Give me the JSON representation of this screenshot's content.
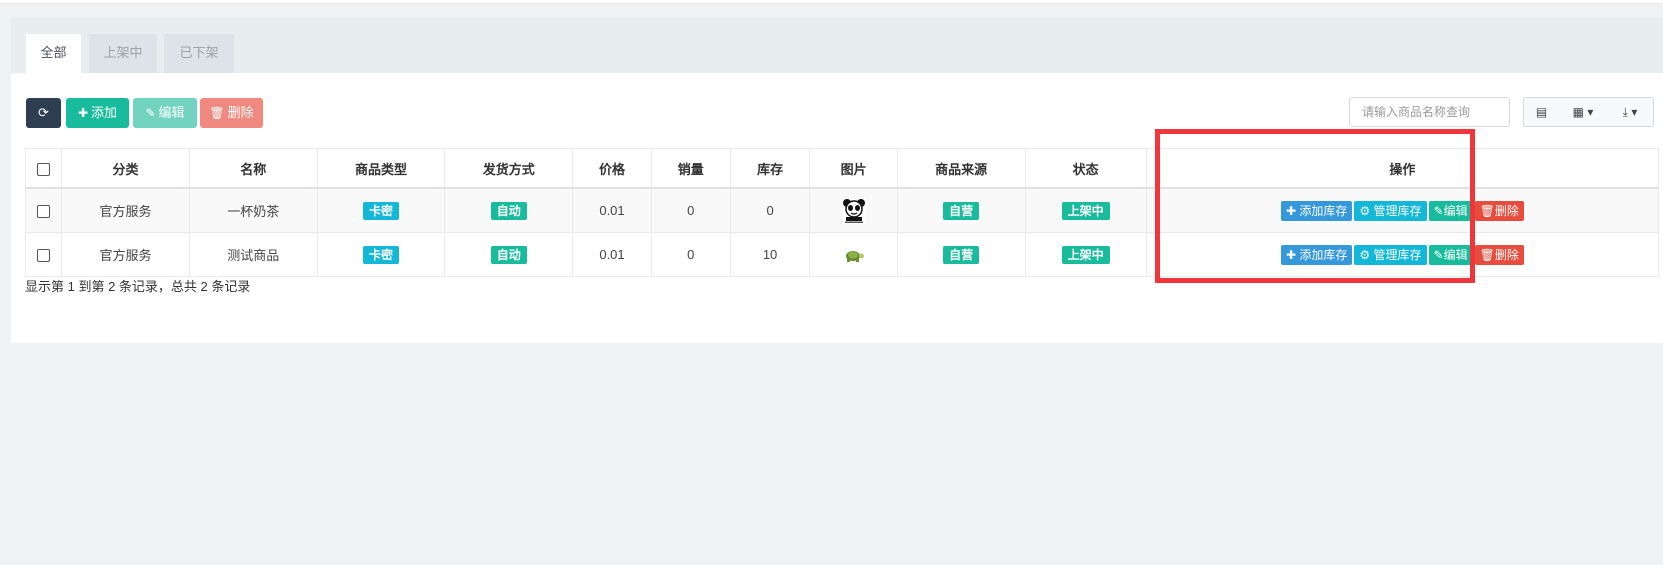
{
  "tabs": [
    "全部",
    "上架中",
    "已下架"
  ],
  "toolbar": {
    "add_label": "添加",
    "edit_label": "编辑",
    "delete_label": "删除",
    "search_placeholder": "请输入商品名称查询"
  },
  "table": {
    "columns": [
      "分类",
      "名称",
      "商品类型",
      "发货方式",
      "价格",
      "销量",
      "库存",
      "图片",
      "商品来源",
      "状态",
      "操作"
    ],
    "rows": [
      {
        "category": "官方服务",
        "name": "一杯奶茶",
        "type": "卡密",
        "delivery": "自动",
        "price": "0.01",
        "sales": "0",
        "stock": "0",
        "image": "panda-sticker",
        "source": "自营",
        "status": "上架中"
      },
      {
        "category": "官方服务",
        "name": "测试商品",
        "type": "卡密",
        "delivery": "自动",
        "price": "0.01",
        "sales": "0",
        "stock": "10",
        "image": "turtle",
        "source": "自营",
        "status": "上架中"
      }
    ],
    "actions": {
      "add_stock": "添加库存",
      "manage_stock": "管理库存",
      "edit": "编辑",
      "delete": "删除"
    }
  },
  "footer": "显示第 1 到第 2 条记录，总共 2 条记录",
  "colors": {
    "primary_green": "#18bc9c",
    "info": "#13b7d8",
    "blue": "#3498db",
    "danger": "#e74c3c",
    "highlight": "#f0353d"
  }
}
